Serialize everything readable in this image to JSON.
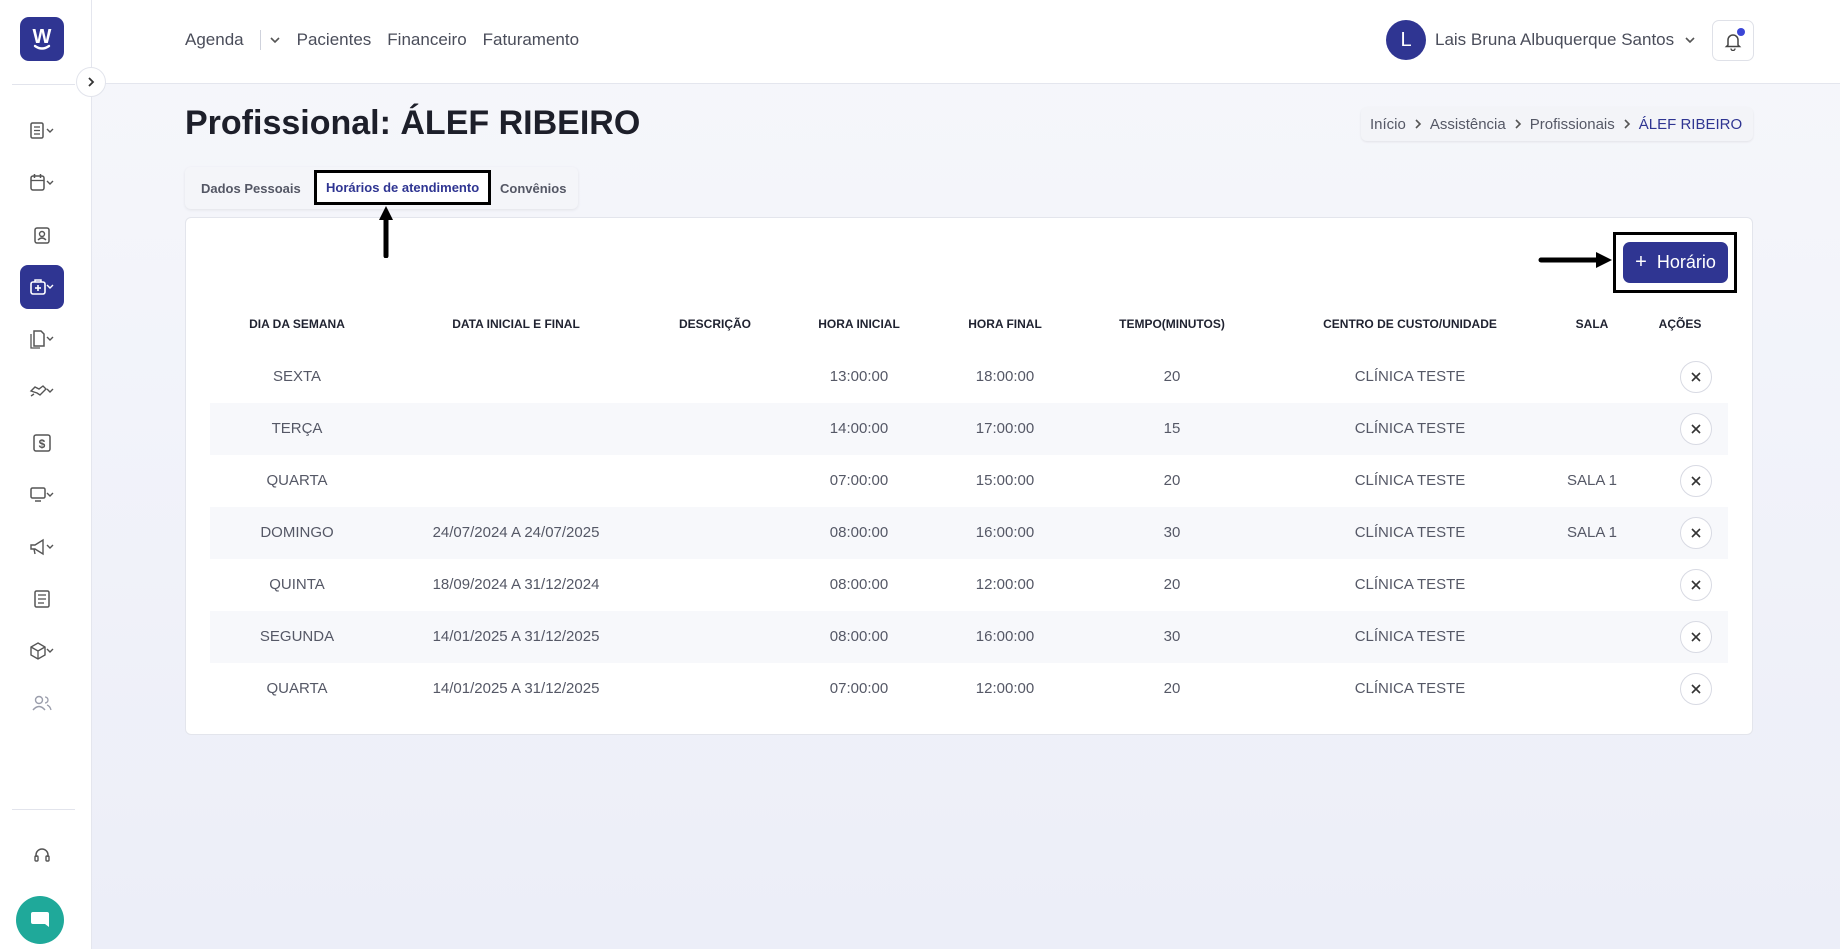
{
  "app": {
    "logo_glyph": "W",
    "brand_color": "#2f3592",
    "accent_teal": "#1fa99a"
  },
  "topnav": {
    "items": [
      "Agenda",
      "Pacientes",
      "Financeiro",
      "Faturamento"
    ]
  },
  "user": {
    "initial": "L",
    "name": "Lais Bruna Albuquerque Santos"
  },
  "sidebar": {
    "icons": [
      "records-icon",
      "calendar-icon",
      "id-badge-icon",
      "medical-bag-icon",
      "documents-icon",
      "handshake-icon",
      "dollar-icon",
      "monitor-icon",
      "megaphone-icon",
      "news-icon",
      "box-icon",
      "users-icon"
    ]
  },
  "page": {
    "title": "Profissional: ÁLEF RIBEIRO",
    "breadcrumb": [
      "Início",
      "Assistência",
      "Profissionais",
      "ÁLEF RIBEIRO"
    ]
  },
  "tabs": {
    "items": [
      "Dados Pessoais",
      "Horários de atendimento",
      "Convênios"
    ],
    "active": "Horários de atendimento"
  },
  "actions": {
    "add_plus": "+",
    "add_label": "Horário"
  },
  "table": {
    "headers": [
      "DIA DA SEMANA",
      "DATA INICIAL E FINAL",
      "DESCRIÇÃO",
      "HORA INICIAL",
      "HORA FINAL",
      "TEMPO(MINUTOS)",
      "CENTRO DE CUSTO/UNIDADE",
      "SALA",
      "AÇÕES"
    ],
    "rows": [
      {
        "dia": "SEXTA",
        "datas": "",
        "descricao": "",
        "hora_inicial": "13:00:00",
        "hora_final": "18:00:00",
        "tempo": "20",
        "centro": "CLÍNICA TESTE",
        "sala": ""
      },
      {
        "dia": "TERÇA",
        "datas": "",
        "descricao": "",
        "hora_inicial": "14:00:00",
        "hora_final": "17:00:00",
        "tempo": "15",
        "centro": "CLÍNICA TESTE",
        "sala": ""
      },
      {
        "dia": "QUARTA",
        "datas": "",
        "descricao": "",
        "hora_inicial": "07:00:00",
        "hora_final": "15:00:00",
        "tempo": "20",
        "centro": "CLÍNICA TESTE",
        "sala": "SALA 1"
      },
      {
        "dia": "DOMINGO",
        "datas": "24/07/2024 A 24/07/2025",
        "descricao": "",
        "hora_inicial": "08:00:00",
        "hora_final": "16:00:00",
        "tempo": "30",
        "centro": "CLÍNICA TESTE",
        "sala": "SALA 1"
      },
      {
        "dia": "QUINTA",
        "datas": "18/09/2024 A 31/12/2024",
        "descricao": "",
        "hora_inicial": "08:00:00",
        "hora_final": "12:00:00",
        "tempo": "20",
        "centro": "CLÍNICA TESTE",
        "sala": ""
      },
      {
        "dia": "SEGUNDA",
        "datas": "14/01/2025 A 31/12/2025",
        "descricao": "",
        "hora_inicial": "08:00:00",
        "hora_final": "16:00:00",
        "tempo": "30",
        "centro": "CLÍNICA TESTE",
        "sala": ""
      },
      {
        "dia": "QUARTA",
        "datas": "14/01/2025 A 31/12/2025",
        "descricao": "",
        "hora_inicial": "07:00:00",
        "hora_final": "12:00:00",
        "tempo": "20",
        "centro": "CLÍNICA TESTE",
        "sala": ""
      }
    ]
  }
}
